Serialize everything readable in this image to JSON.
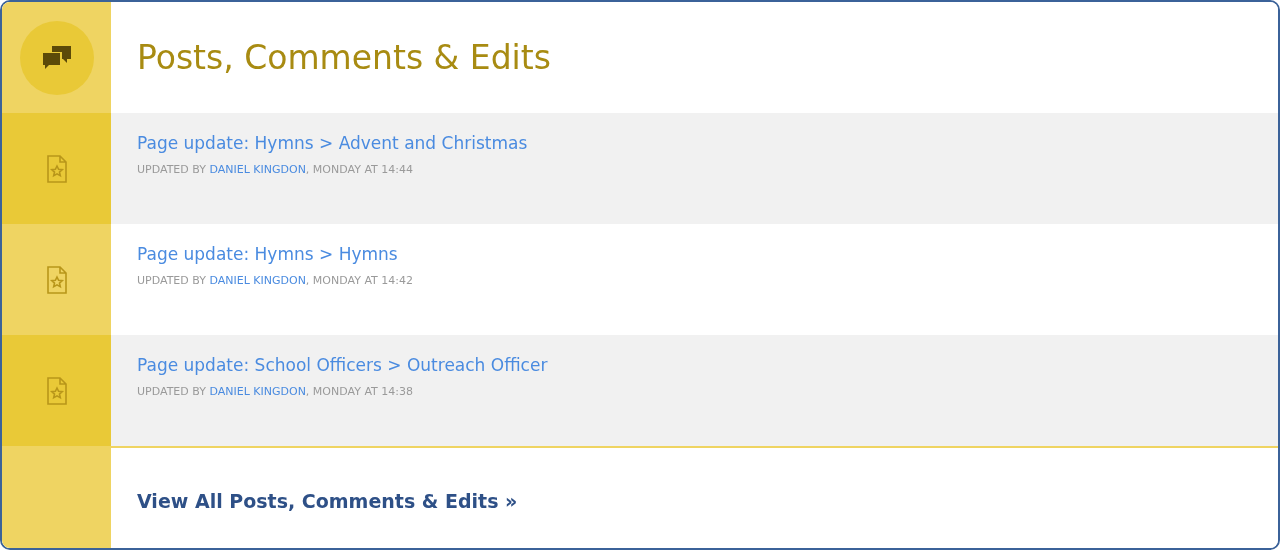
{
  "header": {
    "title": "Posts, Comments & Edits"
  },
  "activities": [
    {
      "title": "Page update: Hymns > Advent and Christmas",
      "byline_prefix": "UPDATED BY",
      "author": "DANIEL KINGDON",
      "byline_suffix": ", MONDAY AT 14:44"
    },
    {
      "title": "Page update: Hymns > Hymns",
      "byline_prefix": "UPDATED BY",
      "author": "DANIEL KINGDON",
      "byline_suffix": ", MONDAY AT 14:42"
    },
    {
      "title": "Page update: School Officers > Outreach Officer",
      "byline_prefix": "UPDATED BY",
      "author": "DANIEL KINGDON",
      "byline_suffix": ", MONDAY AT 14:38"
    }
  ],
  "footer": {
    "link": "View All Posts, Comments & Edits »"
  }
}
